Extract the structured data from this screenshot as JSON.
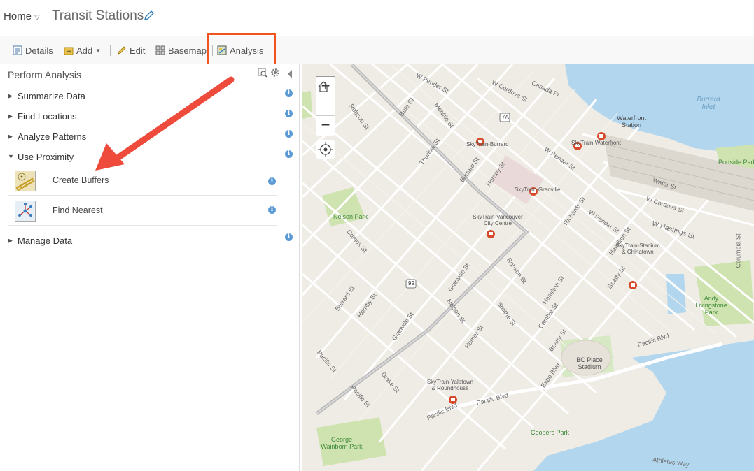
{
  "header": {
    "home": "Home",
    "title": "Transit Stations"
  },
  "toolbar": {
    "details": "Details",
    "add": "Add",
    "edit": "Edit",
    "basemap": "Basemap",
    "analysis": "Analysis"
  },
  "panel": {
    "title": "Perform Analysis",
    "sections": [
      {
        "label": "Summarize Data",
        "expanded": false
      },
      {
        "label": "Find Locations",
        "expanded": false
      },
      {
        "label": "Analyze Patterns",
        "expanded": false
      },
      {
        "label": "Use Proximity",
        "expanded": true
      },
      {
        "label": "Manage Data",
        "expanded": false
      }
    ],
    "tools": [
      {
        "label": "Create Buffers"
      },
      {
        "label": "Find Nearest"
      }
    ]
  },
  "map": {
    "labels": {
      "w_pender": "W Pender St",
      "w_cordova": "W Cordova St",
      "canada_pl": "Canada Pl",
      "burrard_inlet": "Burrard Inlet",
      "waterfront": "Waterfront Station",
      "robson": "Robson St",
      "bute": "Bute St",
      "melville": "Melville St",
      "thurlow": "Thurlow St",
      "burrard": "Burrard St",
      "hornby": "Hornby St",
      "sky_burrard": "SkyTrain-Burrard",
      "sky_waterfront": "SkyTrain-Waterfront",
      "sky_granville": "SkyTrain-Granville",
      "sky_vcc": "SkyTrain-Vancouver City Centre",
      "sky_stadium": "SkyTrain-Stadium & Chinatown",
      "sky_yaletown": "SkyTrain-Yaletown & Roundhouse",
      "portside": "Portside Park",
      "water_st": "Water St",
      "w_hastings": "W Hastings St",
      "richards": "Richards St",
      "hamilton": "Hamilton St",
      "nelson_park": "Nelson Park",
      "comox": "Comox St",
      "granville": "Granville St",
      "nelson": "Nelson St",
      "smithe": "Smithe St",
      "cambie": "Cambie St",
      "beatty": "Beatty St",
      "homer": "Homer St",
      "bc_place": "BC Place Stadium",
      "expo": "Expo Blvd",
      "pacific_blvd": "Pacific Blvd",
      "drake": "Drake St",
      "pacific_st": "Pacific St",
      "andy": "Andy Livingstone Park",
      "george": "George Wainborn Park",
      "coopers": "Coopers Park",
      "athletes": "Athletes Way",
      "columbia": "Columbia St",
      "hwy_7a": "7A",
      "hwy_99": "99"
    }
  }
}
